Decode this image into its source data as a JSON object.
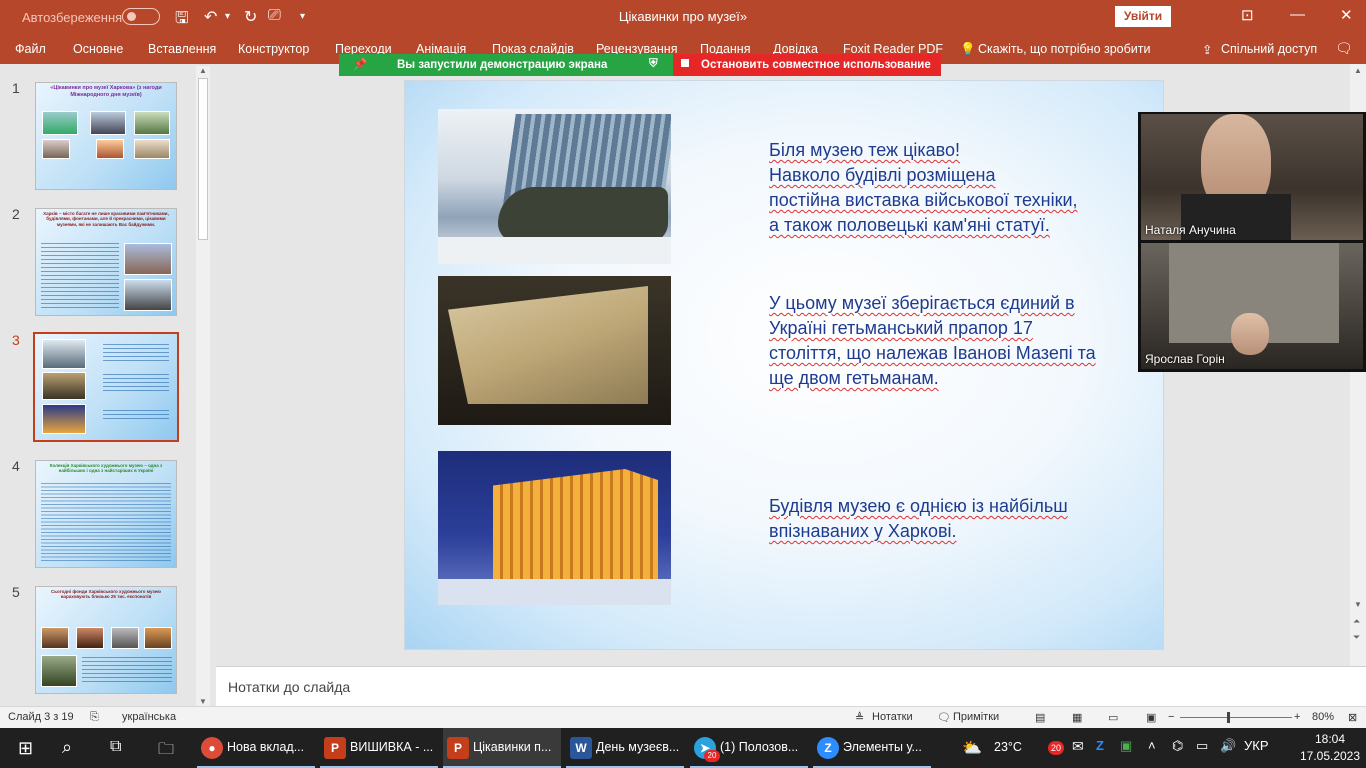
{
  "titlebar": {
    "autosave_label": "Автозбереження",
    "doc_title": "Цікавинки про музеї»",
    "signin_label": "Увійти"
  },
  "ribbon": {
    "tabs": [
      "Файл",
      "Основне",
      "Вставлення",
      "Конструктор",
      "Переходи",
      "Анімація",
      "Показ слайдів",
      "Рецензування",
      "Подання",
      "Довідка",
      "Foxit Reader PDF",
      "Скажіть, що потрібно зробити",
      "Спільний доступ"
    ]
  },
  "share_banner": {
    "started_text": "Вы запустили демонстрацию экрана",
    "stop_text": "Остановить совместное использование"
  },
  "thumbnails": [
    {
      "num": "1",
      "title": "«Цікавинки про музеї Харкова» (з нагоди Міжнародного дня музеїв)"
    },
    {
      "num": "2",
      "title": "Харків – місто багате не лише красивими пам'ятниками, будівлями, фонтанами, але й прекрасними, цікавими музеями, які не залишають Вас байдужими."
    },
    {
      "num": "3",
      "title": ""
    },
    {
      "num": "4",
      "title": "Колекція Харківського художнього музею – одна з найбільших і одна з найстаріших в Україні"
    },
    {
      "num": "5",
      "title": "Сьогодні фонди Харківського художнього музею нараховують близько 25 тис. експонатів"
    }
  ],
  "slide": {
    "paragraph1": [
      "Біля музею теж цікаво!",
      "Навколо будівлі розміщена",
      "постійна виставка військової техніки,",
      "а також половецькі кам'яні статуї."
    ],
    "paragraph2": [
      "У цьому музеї зберігається єдиний в",
      "Україні гетьманський прапор 17",
      "століття, що належав Іванові Мазепі та",
      "ще двом гетьманам."
    ],
    "paragraph3": [
      "Будівля музею є однією із найбільш",
      "впізнаваних у Харкові."
    ]
  },
  "notes_placeholder": "Нотатки до слайда",
  "video_participants": [
    {
      "name": "Наталя Анучина"
    },
    {
      "name": "Ярослав Горін"
    }
  ],
  "statusbar": {
    "slide_counter": "Слайд 3 з 19",
    "language": "українська",
    "notes_label": "Нотатки",
    "comments_label": "Примітки",
    "zoom": "80%"
  },
  "taskbar": {
    "items": [
      {
        "label": "Нова вклад...",
        "icon": "chrome-icon",
        "color": "#dd4b39"
      },
      {
        "label": "ВИШИВКА - ...",
        "icon": "powerpoint-icon",
        "color": "#c43e1c"
      },
      {
        "label": "Цікавинки п...",
        "icon": "powerpoint-icon",
        "color": "#c43e1c"
      },
      {
        "label": "День музеєв...",
        "icon": "word-icon",
        "color": "#2b579a"
      },
      {
        "label": "(1) Полозов...",
        "icon": "telegram-icon",
        "color": "#2aa3dd"
      },
      {
        "label": "Элементы у...",
        "icon": "zoom-icon",
        "color": "#2d8cff"
      }
    ],
    "temperature": "23°C",
    "lang": "УКР",
    "time": "18:04",
    "date": "17.05.2023",
    "badge": "20"
  }
}
